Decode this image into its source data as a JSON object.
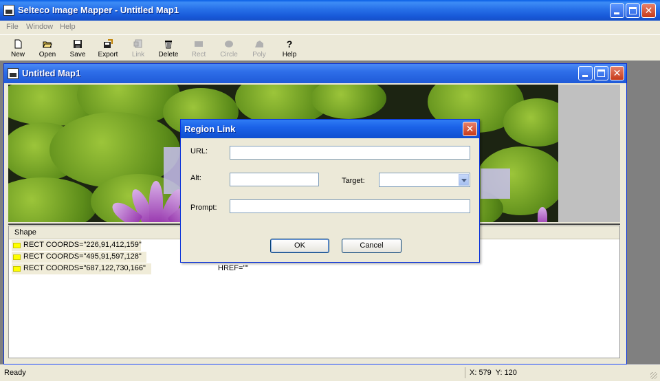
{
  "window": {
    "title": "Selteco Image Mapper - Untitled Map1"
  },
  "menu": [
    "File",
    "Window",
    "Help"
  ],
  "toolbar": {
    "new": "New",
    "open": "Open",
    "save": "Save",
    "export": "Export",
    "link": "Link",
    "delete": "Delete",
    "rect": "Rect",
    "circle": "Circle",
    "poly": "Poly",
    "help": "Help"
  },
  "child": {
    "title": "Untitled Map1"
  },
  "list": {
    "header": "Shape",
    "rows": [
      "RECT COORDS=\"226,91,412,159\"",
      "RECT COORDS=\"495,91,597,128\"",
      "RECT COORDS=\"687,122,730,166\""
    ],
    "href_text": "HREF=\"\""
  },
  "dialog": {
    "title": "Region Link",
    "url_label": "URL:",
    "url_value": "",
    "alt_label": "Alt:",
    "alt_value": "",
    "target_label": "Target:",
    "target_value": "",
    "prompt_label": "Prompt:",
    "prompt_value": "",
    "ok": "OK",
    "cancel": "Cancel"
  },
  "status": {
    "ready": "Ready",
    "coords": "X: 579  Y: 120"
  },
  "colors": {
    "title_blue": "#0a5fe6",
    "face": "#ece9d8",
    "selection": "#c8c0ee",
    "shape_swatch": "#ffff00"
  },
  "icons": [
    "app-icon",
    "new-icon",
    "open-icon",
    "save-icon",
    "export-icon",
    "link-icon",
    "delete-icon",
    "rect-icon",
    "circle-icon",
    "poly-icon",
    "help-icon",
    "minimize-icon",
    "maximize-icon",
    "close-icon",
    "dropdown-arrow-icon"
  ]
}
